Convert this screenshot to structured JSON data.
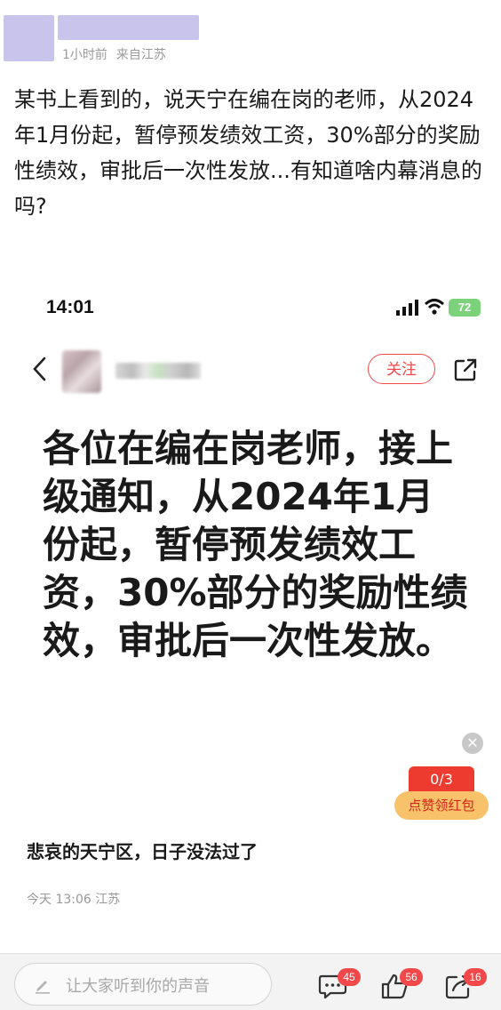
{
  "post": {
    "meta_time": "1小时前",
    "meta_location": "来自江苏",
    "body": "某书上看到的，说天宁在编在岗的老师，从2024年1月份起，暂停预发绩效工资，30%部分的奖励性绩效，审批后一次性发放...有知道啥内幕消息的吗?"
  },
  "screenshot": {
    "status_time": "14:01",
    "battery": "72",
    "follow_label": "关注",
    "big_text": "各位在编在岗老师，接上级通知，从2024年1月份起，暂停预发绩效工资，30%部分的奖励性绩效，审批后一次性发放。",
    "close_glyph": "✕",
    "redpack_count": "0/3",
    "redpack_label": "点赞领红包",
    "caption": "悲哀的天宁区，日子没法过了",
    "date_line": "今天 13:06 江苏"
  },
  "bottom": {
    "comment_placeholder": "让大家听到你的声音",
    "comment_count": "45",
    "like_count": "56",
    "share_count": "16"
  },
  "colors": {
    "accent_red": "#f24a4a",
    "redacted_block": "#c9c4ec",
    "battery_green": "#7bd27b"
  },
  "icons": [
    "signal-icon",
    "wifi-icon",
    "back-arrow-icon",
    "share-icon",
    "close-icon",
    "pen-icon",
    "comment-icon",
    "like-icon",
    "share-out-icon"
  ]
}
